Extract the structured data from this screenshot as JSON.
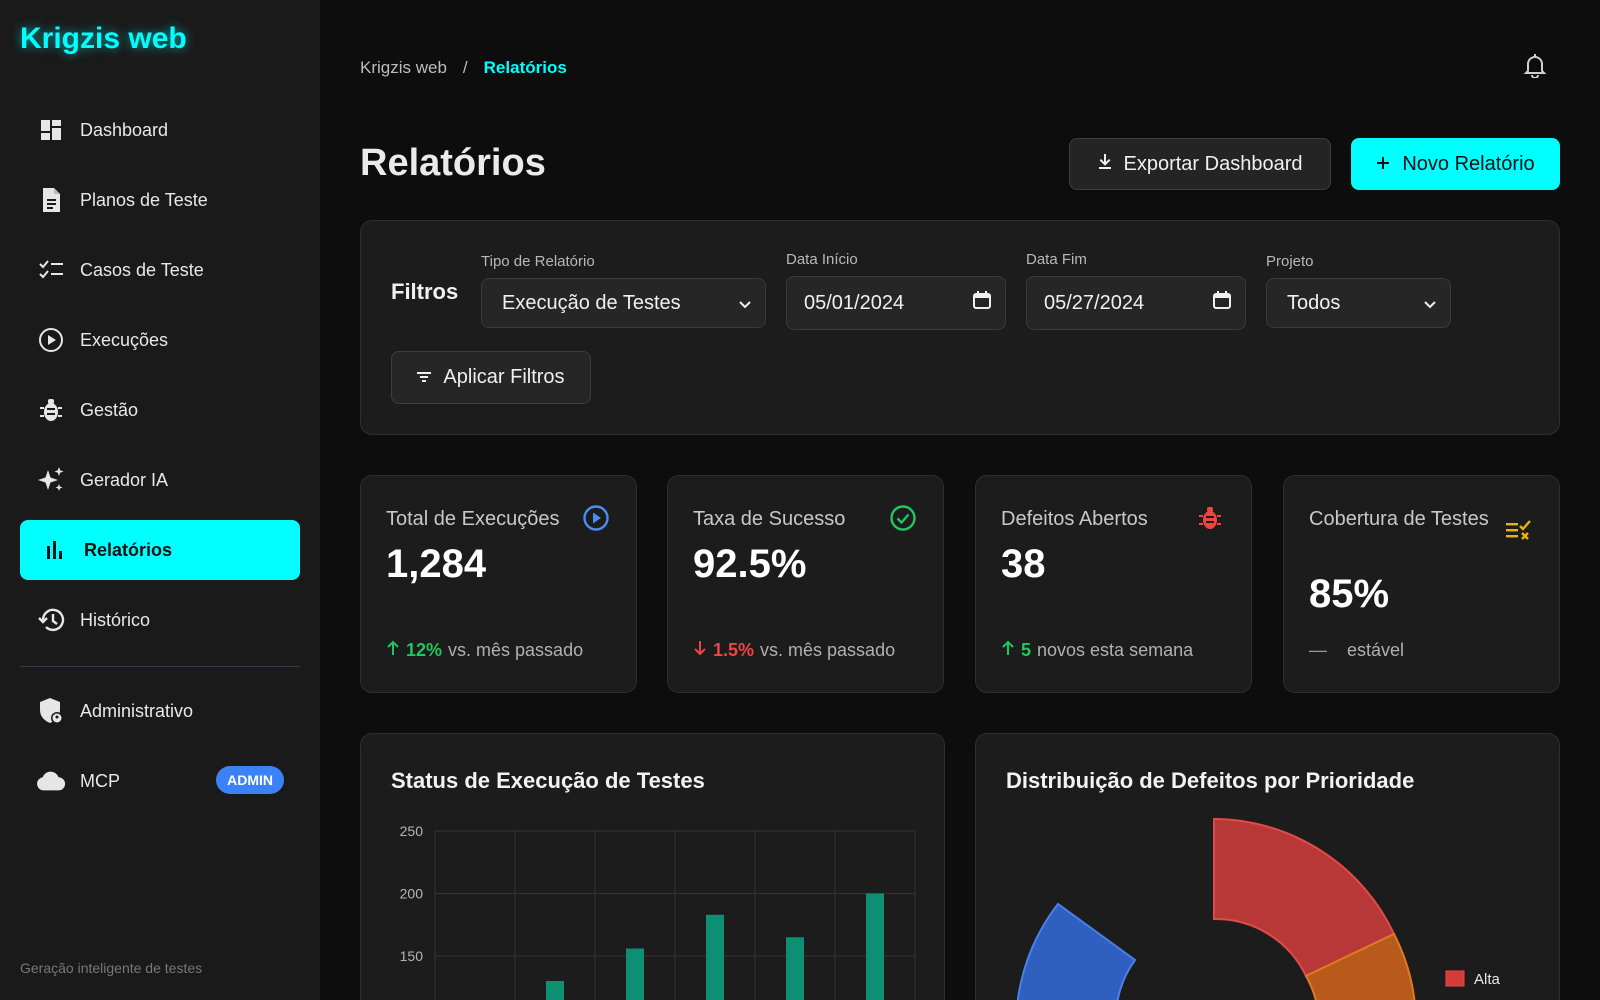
{
  "app": {
    "title": "Krigzis web"
  },
  "sidebar": {
    "items": [
      {
        "label": "Dashboard",
        "icon": "dashboard-icon"
      },
      {
        "label": "Planos de Teste",
        "icon": "document-icon"
      },
      {
        "label": "Casos de Teste",
        "icon": "checklist-icon"
      },
      {
        "label": "Execuções",
        "icon": "play-circle-icon"
      },
      {
        "label": "Gestão",
        "icon": "bug-icon"
      },
      {
        "label": "Gerador IA",
        "icon": "sparkles-icon"
      },
      {
        "label": "Relatórios",
        "icon": "bar-chart-icon",
        "active": true
      },
      {
        "label": "Histórico",
        "icon": "history-icon"
      }
    ],
    "admin_items": [
      {
        "label": "Administrativo",
        "icon": "shield-user-icon"
      },
      {
        "label": "MCP",
        "icon": "cloud-icon",
        "badge": "ADMIN"
      }
    ],
    "footer": "Geração inteligente de testes"
  },
  "breadcrumb": {
    "root": "Krigzis web",
    "separator": "/",
    "current": "Relatórios"
  },
  "page": {
    "title": "Relatórios"
  },
  "actions": {
    "export_label": "Exportar Dashboard",
    "new_label": "Novo Relatório"
  },
  "filters": {
    "title": "Filtros",
    "report_type": {
      "label": "Tipo de Relatório",
      "value": "Execução de Testes"
    },
    "start_date": {
      "label": "Data Início",
      "value": "05/01/2024"
    },
    "end_date": {
      "label": "Data Fim",
      "value": "05/27/2024"
    },
    "project": {
      "label": "Projeto",
      "value": "Todos"
    },
    "apply_label": "Aplicar Filtros"
  },
  "stats": [
    {
      "title": "Total de Execuções",
      "value": "1,284",
      "delta": "12%",
      "trend": "up",
      "foot": "vs. mês passado",
      "color": "#3b82f6"
    },
    {
      "title": "Taxa de Sucesso",
      "value": "92.5%",
      "delta": "1.5%",
      "trend": "down",
      "foot": "vs. mês passado",
      "color": "#22c55e"
    },
    {
      "title": "Defeitos Abertos",
      "value": "38",
      "delta": "5",
      "trend": "up",
      "foot": "novos esta semana",
      "color": "#ef4444"
    },
    {
      "title": "Cobertura de Testes",
      "value": "85%",
      "delta": "—",
      "trend": "flat",
      "foot": "estável",
      "color": "#eab308"
    }
  ],
  "chart_data": [
    {
      "type": "bar",
      "title": "Status de Execução de Testes",
      "yticks": [
        150,
        200,
        250
      ],
      "ylim": [
        0,
        250
      ],
      "grid": true,
      "values": [
        null,
        130,
        156,
        183,
        165,
        200
      ],
      "colors": {
        "bar": "#0d8f74",
        "grid": "#333333"
      }
    },
    {
      "type": "pie",
      "title": "Distribuição de Defeitos por Prioridade",
      "legend": [
        {
          "label": "Alta",
          "color": "#d63b3b"
        }
      ],
      "colors": {
        "alta": "#b83838",
        "media": "#b85a1c",
        "baixa": "#2f60c0"
      },
      "legend_position": "right"
    }
  ]
}
